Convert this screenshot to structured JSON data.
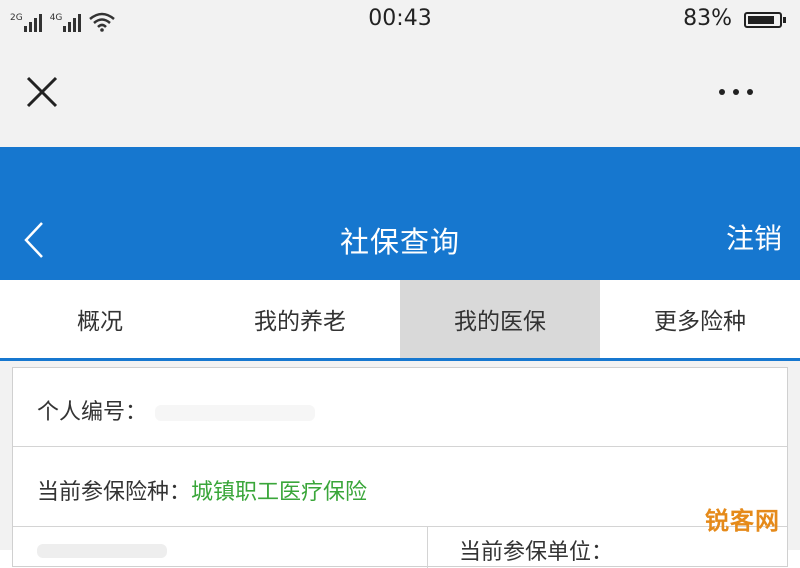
{
  "status_bar": {
    "network_labels": [
      "2G",
      "4G"
    ],
    "time": "00:43",
    "battery_percent": "83%"
  },
  "icons": {
    "close": "close-icon",
    "more": "more-icon",
    "back": "chevron-left-icon",
    "wifi": "wifi-icon",
    "battery": "battery-icon",
    "signal": "signal-icon"
  },
  "header": {
    "title": "社保查询",
    "logout_label": "注销"
  },
  "tabs": [
    {
      "label": "概况",
      "active": false
    },
    {
      "label": "我的养老",
      "active": false
    },
    {
      "label": "我的医保",
      "active": true
    },
    {
      "label": "更多险种",
      "active": false
    }
  ],
  "info": {
    "personal_id_label": "个人编号：",
    "insurance_type_label": "当前参保险种：",
    "insurance_type_value": "城镇职工医疗保险",
    "insured_unit_label": "当前参保单位："
  },
  "colors": {
    "brand_blue": "#1677cf",
    "value_green": "#3aa63a",
    "tab_active_bg": "#d9d9d9"
  },
  "watermark": "锐客网"
}
